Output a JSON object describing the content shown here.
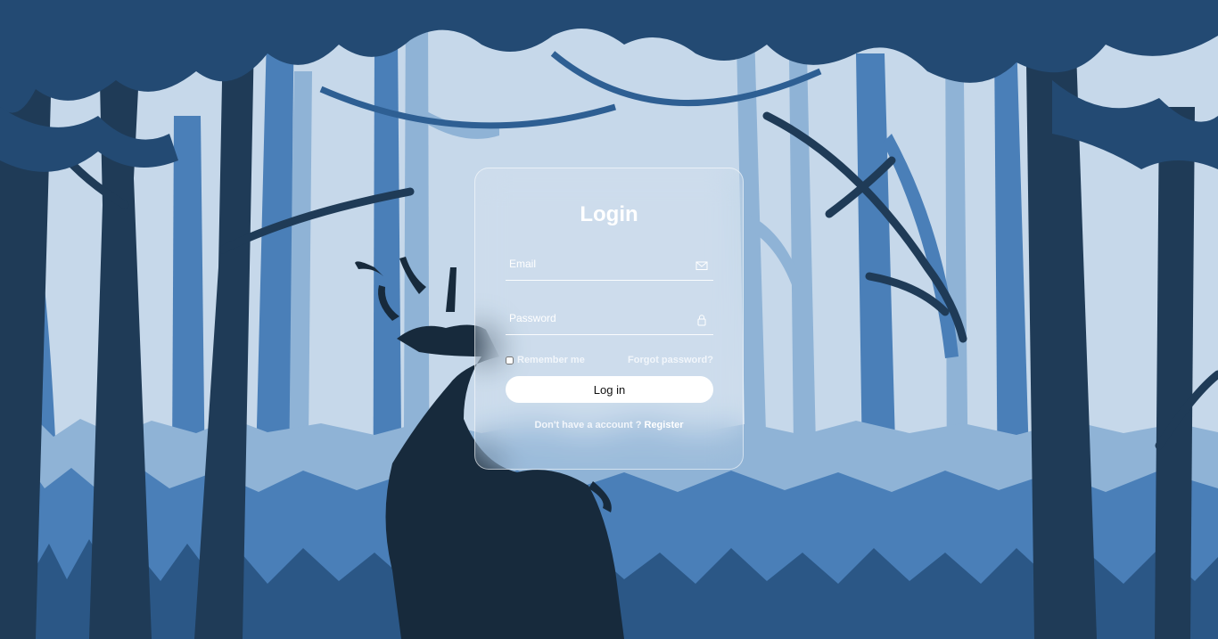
{
  "form": {
    "title": "Login",
    "email_placeholder": "Email",
    "password_placeholder": "Password",
    "remember_label": "Remember me",
    "forgot_label": "Forgot password?",
    "submit_label": "Log in",
    "register_prompt": "Don't have a account ?",
    "register_link": "Register"
  },
  "icons": {
    "email": "envelope-icon",
    "password": "lock-icon"
  },
  "colors": {
    "sky": "#c6d8ea",
    "tree_light": "#7fa6cc",
    "tree_mid": "#4a7fb8",
    "tree_dark": "#1f3b57",
    "silhouette": "#172a3c",
    "button": "#ffffff"
  }
}
